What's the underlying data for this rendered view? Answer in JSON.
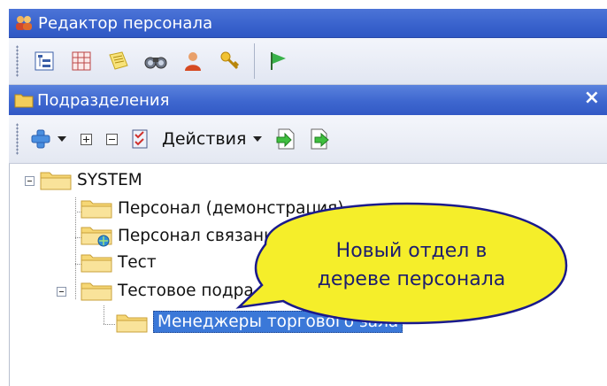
{
  "window": {
    "title": "Редактор персонала"
  },
  "main_toolbar": {
    "buttons": [
      "tree-icon",
      "grid-icon",
      "notes-icon",
      "binoculars-icon",
      "person-icon",
      "keys-icon",
      "flag-icon"
    ]
  },
  "panel": {
    "title": "Подразделения",
    "close_label": "×"
  },
  "panel_toolbar": {
    "actions_label": "Действия"
  },
  "tree": {
    "root": "SYSTEM",
    "items": [
      "Персонал (демонстрация)",
      "Персонал связанны",
      "Тест",
      "Тестовое подра"
    ],
    "selected_child": "Менеджеры торгового зала"
  },
  "callout": {
    "line1": "Новый отдел в",
    "line2": "дереве персонала",
    "fill": "#f5ee2a",
    "stroke": "#1a1a8c"
  },
  "colors": {
    "title_bar": "#3a63cd",
    "selection": "#3b78d8"
  }
}
